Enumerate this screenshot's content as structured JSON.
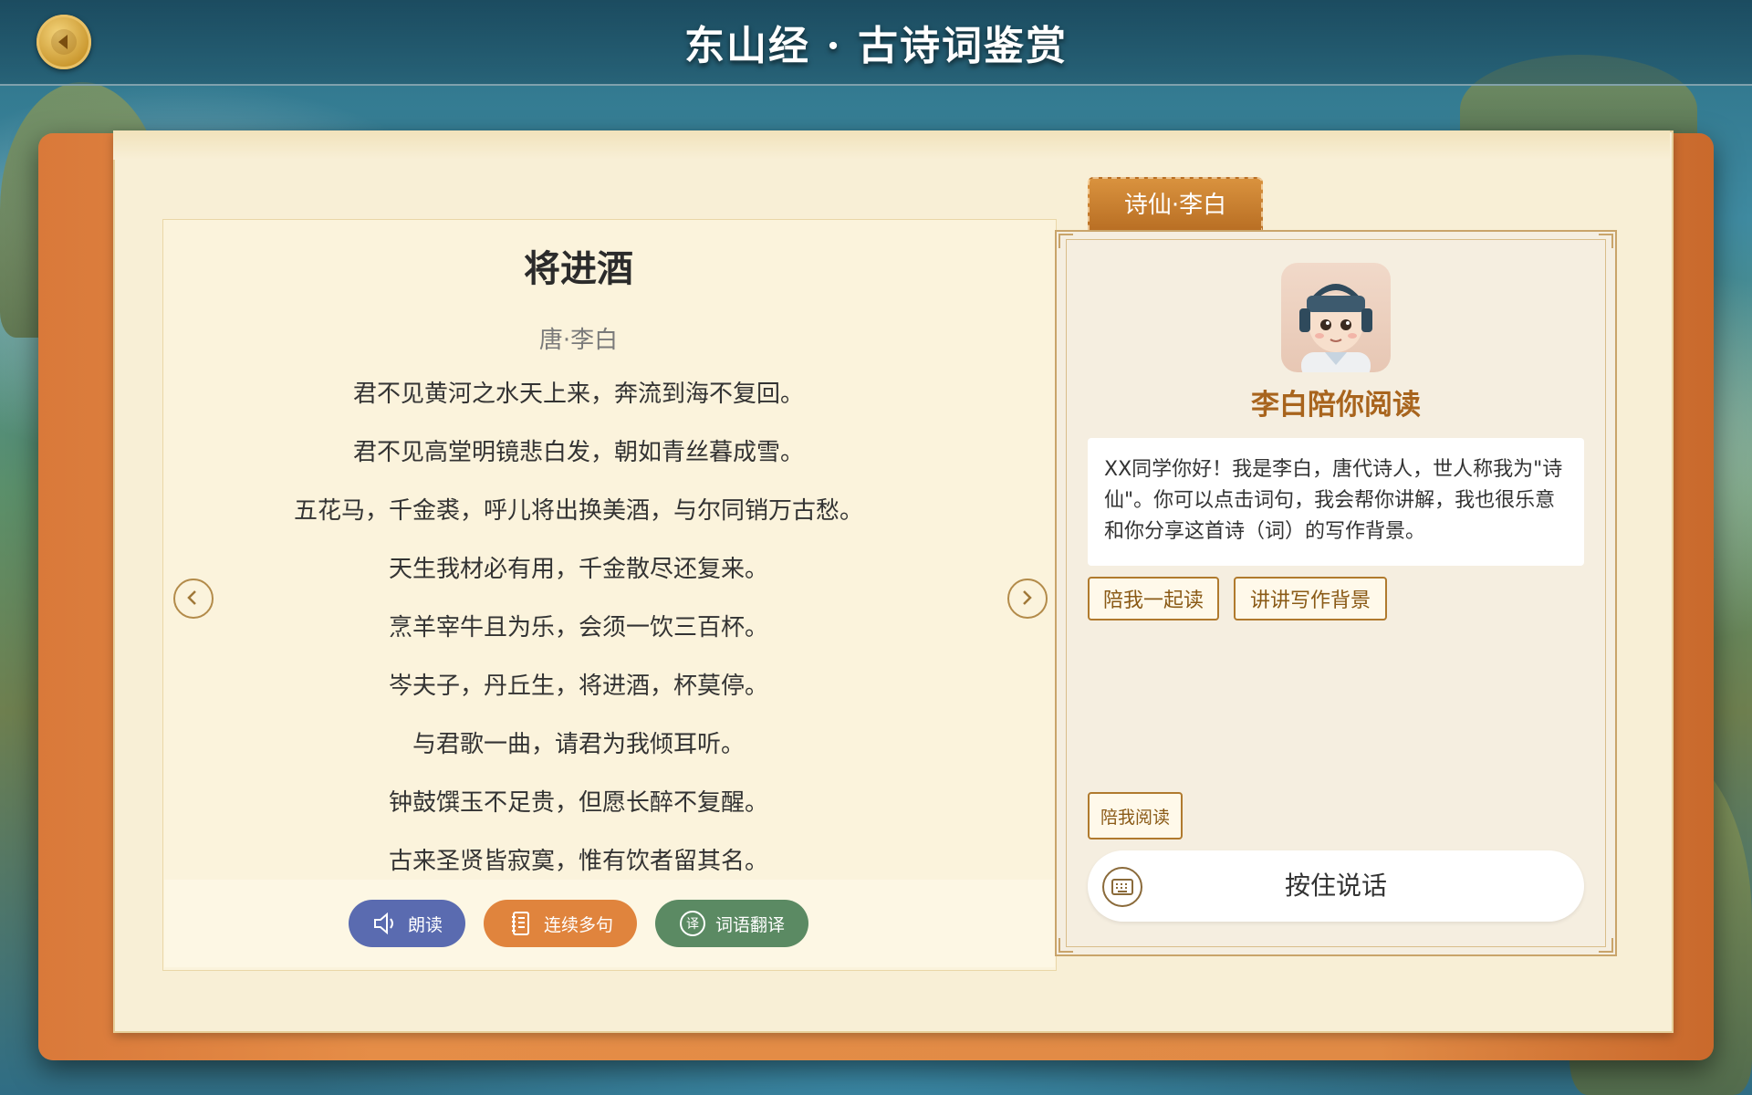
{
  "header": {
    "title": "东山经 · 古诗词鉴赏"
  },
  "poem": {
    "title": "将进酒",
    "author": "唐·李白",
    "lines": [
      "君不见黄河之水天上来，奔流到海不复回。",
      "君不见高堂明镜悲白发，朝如青丝暮成雪。",
      "五花马，千金裘，呼儿将出换美酒，与尔同销万古愁。",
      "天生我材必有用，千金散尽还复来。",
      "烹羊宰牛且为乐，会须一饮三百杯。",
      "岑夫子，丹丘生，将进酒，杯莫停。",
      "与君歌一曲，请君为我倾耳听。",
      "钟鼓馔玉不足贵，但愿长醉不复醒。",
      "古来圣贤皆寂寞，惟有饮者留其名。"
    ]
  },
  "toolbar": {
    "read_aloud": "朗读",
    "continuous": "连续多句",
    "translate": "词语翻译",
    "colors": {
      "read_aloud": "#5a6bb0",
      "continuous": "#e0843d",
      "translate": "#5b8a63"
    }
  },
  "chat": {
    "tab_label": "诗仙·李白",
    "assistant_name": "李白陪你阅读",
    "message": "XX同学你好！我是李白，唐代诗人，世人称我为\"诗仙\"。你可以点击词句，我会帮你讲解，我也很乐意和你分享这首诗（词）的写作背景。",
    "quick_actions": [
      "陪我一起读",
      "讲讲写作背景"
    ],
    "mode_button": "陪我阅读",
    "voice_button": "按住说话"
  }
}
